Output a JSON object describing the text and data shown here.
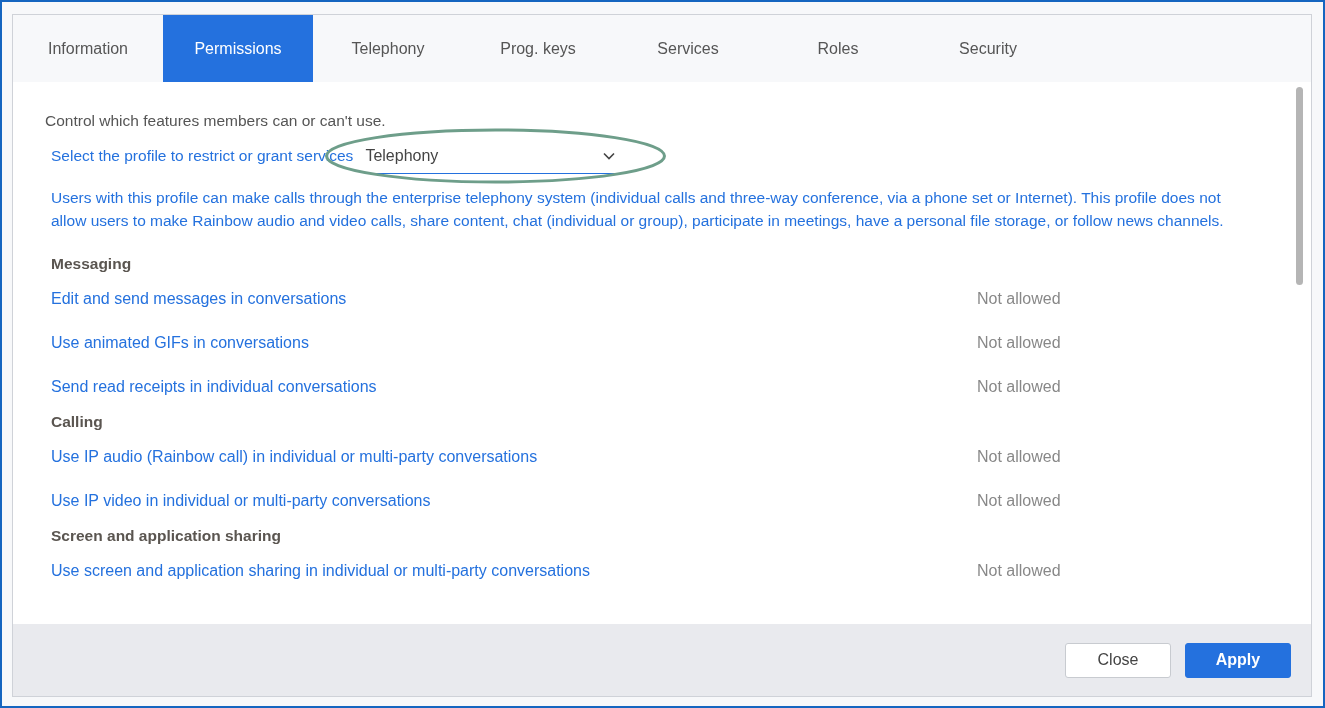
{
  "tabs": [
    {
      "label": "Information",
      "selected": false
    },
    {
      "label": "Permissions",
      "selected": true
    },
    {
      "label": "Telephony",
      "selected": false
    },
    {
      "label": "Prog. keys",
      "selected": false
    },
    {
      "label": "Services",
      "selected": false
    },
    {
      "label": "Roles",
      "selected": false
    },
    {
      "label": "Security",
      "selected": false
    }
  ],
  "intro": "Control which features members can or can't use.",
  "profile_select": {
    "label": "Select the profile to restrict or grant services",
    "value": "Telephony",
    "highlighted": true
  },
  "description": "Users with this profile can make calls through the enterprise telephony system (individual calls and three-way conference, via a phone set or Internet). This profile does not allow users to make Rainbow audio and video calls, share content, chat (individual or group), participate in meetings, have a personal file storage, or follow news channels.",
  "sections": [
    {
      "title": "Messaging",
      "permissions": [
        {
          "label": "Edit and send messages in conversations",
          "status": "Not allowed"
        },
        {
          "label": "Use animated GIFs in conversations",
          "status": "Not allowed"
        },
        {
          "label": "Send read receipts in individual conversations",
          "status": "Not allowed"
        }
      ]
    },
    {
      "title": "Calling",
      "permissions": [
        {
          "label": "Use IP audio (Rainbow call) in individual or multi-party conversations",
          "status": "Not allowed"
        },
        {
          "label": "Use IP video in individual or multi-party conversations",
          "status": "Not allowed"
        }
      ]
    },
    {
      "title": "Screen and application sharing",
      "permissions": [
        {
          "label": "Use screen and application sharing in individual or multi-party conversations",
          "status": "Not allowed"
        }
      ]
    }
  ],
  "buttons": [
    {
      "label": "Close",
      "kind": "secondary"
    },
    {
      "label": "Apply",
      "kind": "primary"
    }
  ]
}
